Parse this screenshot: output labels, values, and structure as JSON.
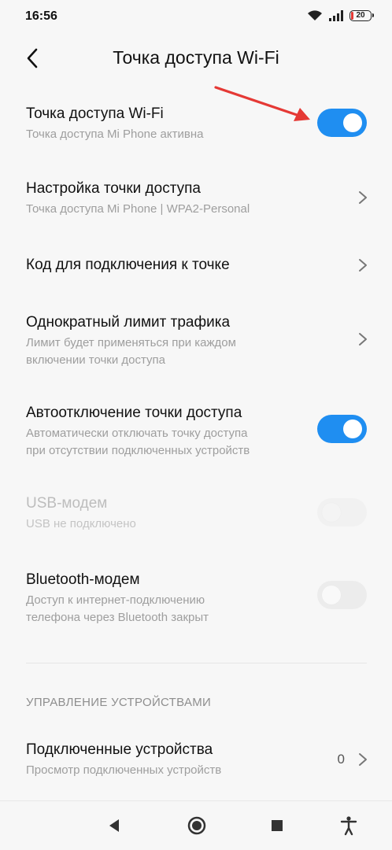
{
  "status_bar": {
    "time": "16:56",
    "battery": "20"
  },
  "header": {
    "title": "Точка доступа Wi-Fi"
  },
  "rows": [
    {
      "title": "Точка доступа Wi-Fi",
      "subtitle": "Точка доступа Mi Phone активна",
      "control": "toggle",
      "state": "on"
    },
    {
      "title": "Настройка точки доступа",
      "subtitle": "Точка доступа Mi Phone | WPA2-Personal",
      "control": "chevron"
    },
    {
      "title": "Код для подключения к точке",
      "subtitle": "",
      "control": "chevron"
    },
    {
      "title": "Однократный лимит трафика",
      "subtitle": "Лимит будет применяться при каждом\nвключении точки доступа",
      "control": "chevron"
    },
    {
      "title": "Автоотключение точки доступа",
      "subtitle": "Автоматически отключать точку доступа\nпри отсутствии подключенных устройств",
      "control": "toggle",
      "state": "on"
    },
    {
      "title": "USB-модем",
      "subtitle": "USB не подключено",
      "control": "toggle",
      "state": "off",
      "disabled": true
    },
    {
      "title": "Bluetooth-модем",
      "subtitle": "Доступ к интернет-подключению\nтелефона через Bluetooth закрыт",
      "control": "toggle",
      "state": "off"
    }
  ],
  "device_section": {
    "header": "УПРАВЛЕНИЕ УСТРОЙСТВАМИ",
    "connected": {
      "title": "Подключенные устройства",
      "subtitle": "Просмотр подключенных устройств",
      "count": "0"
    }
  },
  "colors": {
    "accent": "#1f8ef1",
    "annotation_arrow": "#e53935",
    "background": "#f7f7f7"
  },
  "icons": [
    "wifi-icon",
    "signal-icon",
    "battery-icon",
    "back-arrow-icon",
    "chevron-right-icon",
    "nav-back-icon",
    "nav-home-icon",
    "nav-recents-icon",
    "accessibility-icon"
  ]
}
